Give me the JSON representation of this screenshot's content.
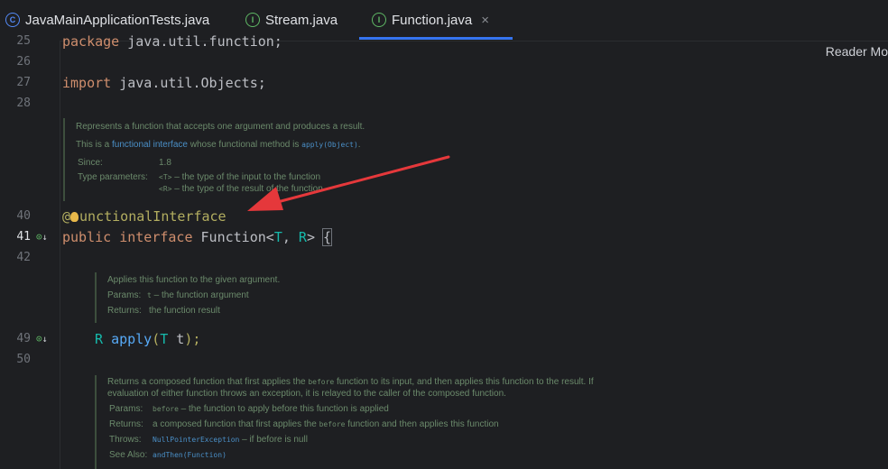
{
  "tabs": [
    {
      "icon": "C",
      "label": "JavaMainApplicationTests.java"
    },
    {
      "icon": "I",
      "label": "Stream.java"
    },
    {
      "icon": "I",
      "label": "Function.java",
      "close": "×"
    }
  ],
  "reader_mode": "Reader Mo",
  "lines": {
    "l25": "25",
    "l26": "26",
    "l27": "27",
    "l28": "28",
    "l40": "40",
    "l41": "41",
    "l42": "42",
    "l49": "49",
    "l50": "50"
  },
  "code": {
    "package_kw": "package",
    "package_name": " java.util.function;",
    "import_kw": "import",
    "import_name": " java.util.Objects;",
    "annotation_at": "@",
    "annotation_name": "unctionalInterface",
    "public_kw": "public",
    "interface_kw": "interface",
    "class_name": "Function<",
    "type_t": "T",
    "comma": ", ",
    "type_r": "R",
    "close_gen": "> ",
    "open_brace": "{",
    "apply_r": "R",
    "apply_name": "apply",
    "apply_open": "(",
    "apply_t": "T",
    "apply_param": " t",
    "apply_close": ");"
  },
  "doc1": {
    "summary": "Represents a function that accepts one argument and produces a result.",
    "line2_pre": "This is a ",
    "line2_link": "functional interface",
    "line2_mid": " whose functional method is ",
    "line2_code": "apply(Object)",
    "line2_end": ".",
    "since_label": "Since:",
    "since_value": "1.8",
    "params_label": "Type parameters:",
    "param1_code": "<T>",
    "param1_text": " – the type of the input to the function",
    "param2_code": "<R>",
    "param2_text": " – the type of the result of the function"
  },
  "doc2": {
    "summary": "Applies this function to the given argument.",
    "params_label": "Params:",
    "params_code": "t",
    "params_text": " – the function argument",
    "returns_label": "Returns:",
    "returns_text": "the function result"
  },
  "doc3": {
    "summary1_pre": "Returns a composed function that first applies the ",
    "summary1_code": "before",
    "summary1_post": " function to its input, and then applies this function to the result. If",
    "summary2": "evaluation of either function throws an exception, it is relayed to the caller of the composed function.",
    "params_label": "Params:",
    "params_code": "before",
    "params_text": " – the function to apply before this function is applied",
    "returns_label": "Returns:",
    "returns_pre": "a composed function that first applies the ",
    "returns_code": "before",
    "returns_post": " function and then applies this function",
    "throws_label": "Throws:",
    "throws_code": "NullPointerException",
    "throws_text": " – if before is null",
    "see_label": "See Also:",
    "see_code": "andThen(Function)"
  },
  "colors": {
    "accent": "#3574f0",
    "arrow": "#e5383b",
    "background": "#1e1f22"
  }
}
